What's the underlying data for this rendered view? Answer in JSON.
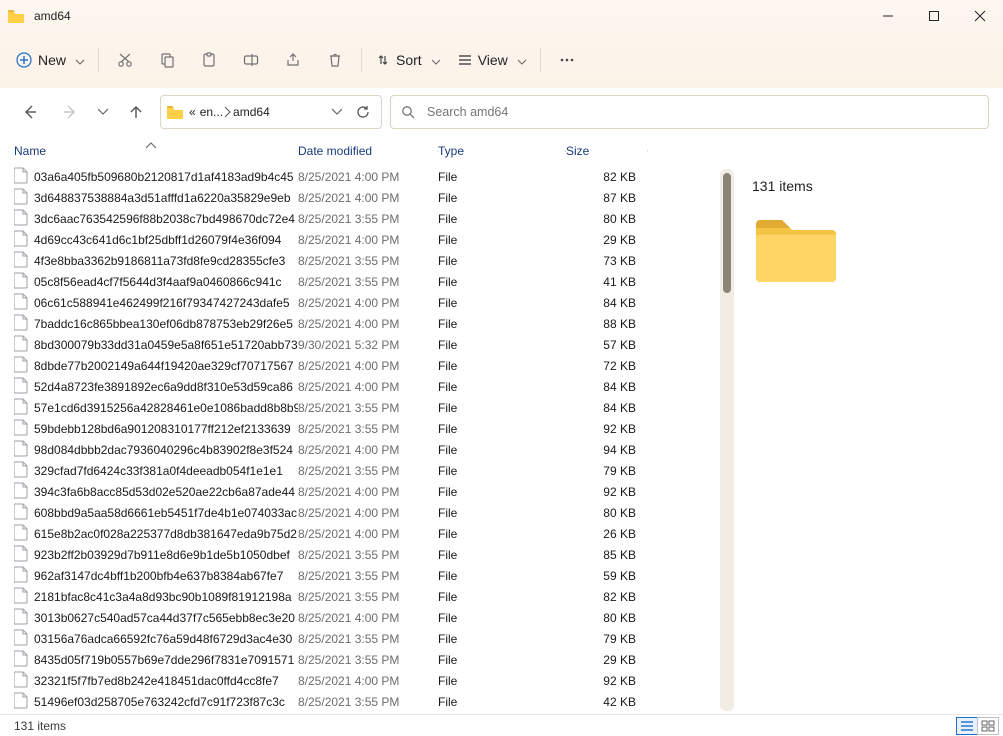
{
  "window": {
    "title": "amd64"
  },
  "cmdbar": {
    "new_label": "New",
    "sort_label": "Sort",
    "view_label": "View"
  },
  "breadcrumb": {
    "crumb1": "en...",
    "crumb2": "amd64"
  },
  "search": {
    "placeholder": "Search amd64"
  },
  "columns": {
    "name": "Name",
    "date": "Date modified",
    "type": "Type",
    "size": "Size"
  },
  "details": {
    "count_label": "131 items"
  },
  "status": {
    "left": "131 items"
  },
  "files": [
    {
      "name": "03a6a405fb509680b2120817d1af4183ad9b4c45",
      "date": "8/25/2021 4:00 PM",
      "type": "File",
      "size": "82 KB"
    },
    {
      "name": "3d648837538884a3d51afffd1a6220a35829e9eb",
      "date": "8/25/2021 4:00 PM",
      "type": "File",
      "size": "87 KB"
    },
    {
      "name": "3dc6aac763542596f88b2038c7bd498670dc72e4",
      "date": "8/25/2021 3:55 PM",
      "type": "File",
      "size": "80 KB"
    },
    {
      "name": "4d69cc43c641d6c1bf25dbff1d26079f4e36f094",
      "date": "8/25/2021 4:00 PM",
      "type": "File",
      "size": "29 KB"
    },
    {
      "name": "4f3e8bba3362b9186811a73fd8fe9cd28355cfe3",
      "date": "8/25/2021 3:55 PM",
      "type": "File",
      "size": "73 KB"
    },
    {
      "name": "05c8f56ead4cf7f5644d3f4aaf9a0460866c941c",
      "date": "8/25/2021 3:55 PM",
      "type": "File",
      "size": "41 KB"
    },
    {
      "name": "06c61c588941e462499f216f79347427243dafe5",
      "date": "8/25/2021 4:00 PM",
      "type": "File",
      "size": "84 KB"
    },
    {
      "name": "7baddc16c865bbea130ef06db878753eb29f26e5",
      "date": "8/25/2021 4:00 PM",
      "type": "File",
      "size": "88 KB"
    },
    {
      "name": "8bd300079b33dd31a0459e5a8f651e51720abb73",
      "date": "9/30/2021 5:32 PM",
      "type": "File",
      "size": "57 KB"
    },
    {
      "name": "8dbde77b2002149a644f19420ae329cf70717567",
      "date": "8/25/2021 4:00 PM",
      "type": "File",
      "size": "72 KB"
    },
    {
      "name": "52d4a8723fe3891892ec6a9dd8f310e53d59ca86",
      "date": "8/25/2021 4:00 PM",
      "type": "File",
      "size": "84 KB"
    },
    {
      "name": "57e1cd6d3915256a42828461e0e1086badd8b8b9",
      "date": "8/25/2021 3:55 PM",
      "type": "File",
      "size": "84 KB"
    },
    {
      "name": "59bdebb128bd6a901208310177ff212ef2133639",
      "date": "8/25/2021 3:55 PM",
      "type": "File",
      "size": "92 KB"
    },
    {
      "name": "98d084dbbb2dac7936040296c4b83902f8e3f524",
      "date": "8/25/2021 4:00 PM",
      "type": "File",
      "size": "94 KB"
    },
    {
      "name": "329cfad7fd6424c33f381a0f4deeadb054f1e1e1",
      "date": "8/25/2021 3:55 PM",
      "type": "File",
      "size": "79 KB"
    },
    {
      "name": "394c3fa6b8acc85d53d02e520ae22cb6a87ade44",
      "date": "8/25/2021 4:00 PM",
      "type": "File",
      "size": "92 KB"
    },
    {
      "name": "608bbd9a5aa58d6661eb5451f7de4b1e074033ac",
      "date": "8/25/2021 4:00 PM",
      "type": "File",
      "size": "80 KB"
    },
    {
      "name": "615e8b2ac0f028a225377d8db381647eda9b75d2",
      "date": "8/25/2021 4:00 PM",
      "type": "File",
      "size": "26 KB"
    },
    {
      "name": "923b2ff2b03929d7b911e8d6e9b1de5b1050dbef",
      "date": "8/25/2021 3:55 PM",
      "type": "File",
      "size": "85 KB"
    },
    {
      "name": "962af3147dc4bff1b200bfb4e637b8384ab67fe7",
      "date": "8/25/2021 3:55 PM",
      "type": "File",
      "size": "59 KB"
    },
    {
      "name": "2181bfac8c41c3a4a8d93bc90b1089f81912198a",
      "date": "8/25/2021 3:55 PM",
      "type": "File",
      "size": "82 KB"
    },
    {
      "name": "3013b0627c540ad57ca44d37f7c565ebb8ec3e20",
      "date": "8/25/2021 4:00 PM",
      "type": "File",
      "size": "80 KB"
    },
    {
      "name": "03156a76adca66592fc76a59d48f6729d3ac4e30",
      "date": "8/25/2021 3:55 PM",
      "type": "File",
      "size": "79 KB"
    },
    {
      "name": "8435d05f719b0557b69e7dde296f7831e7091571",
      "date": "8/25/2021 3:55 PM",
      "type": "File",
      "size": "29 KB"
    },
    {
      "name": "32321f5f7fb7ed8b242e418451dac0ffd4cc8fe7",
      "date": "8/25/2021 4:00 PM",
      "type": "File",
      "size": "92 KB"
    },
    {
      "name": "51496ef03d258705e763242cfd7c91f723f87c3c",
      "date": "8/25/2021 3:55 PM",
      "type": "File",
      "size": "42 KB"
    }
  ]
}
